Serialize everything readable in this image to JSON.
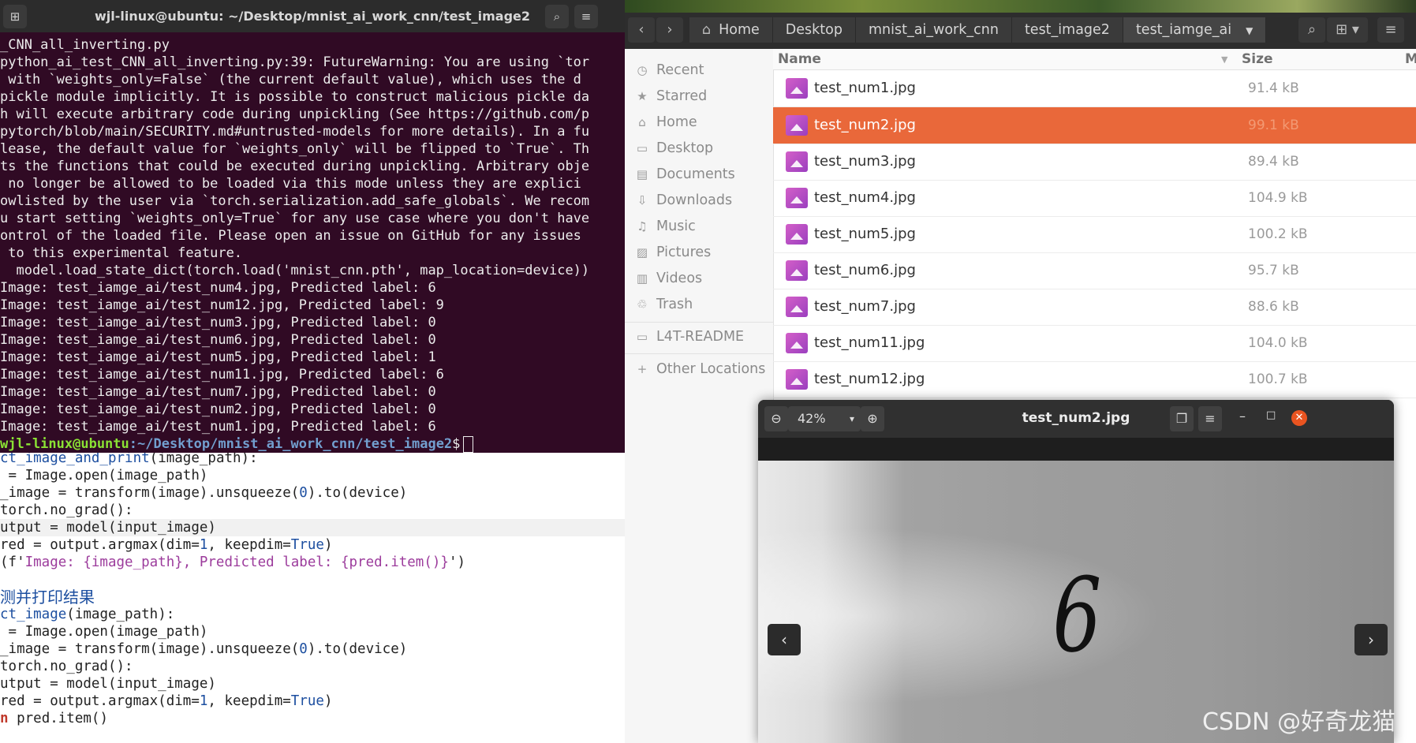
{
  "terminal": {
    "title": "wjl-linux@ubuntu: ~/Desktop/mnist_ai_work_cnn/test_image2",
    "lines": [
      "_CNN_all_inverting.py",
      "python_ai_test_CNN_all_inverting.py:39: FutureWarning: You are using `tor",
      " with `weights_only=False` (the current default value), which uses the d",
      "pickle module implicitly. It is possible to construct malicious pickle da",
      "h will execute arbitrary code during unpickling (See https://github.com/p",
      "pytorch/blob/main/SECURITY.md#untrusted-models for more details). In a fu",
      "lease, the default value for `weights_only` will be flipped to `True`. Th",
      "ts the functions that could be executed during unpickling. Arbitrary obje",
      " no longer be allowed to be loaded via this mode unless they are explici",
      "owlisted by the user via `torch.serialization.add_safe_globals`. We recom",
      "u start setting `weights_only=True` for any use case where you don't have",
      "ontrol of the loaded file. Please open an issue on GitHub for any issues",
      " to this experimental feature.",
      "  model.load_state_dict(torch.load('mnist_cnn.pth', map_location=device))",
      "Image: test_iamge_ai/test_num4.jpg, Predicted label: 6",
      "Image: test_iamge_ai/test_num12.jpg, Predicted label: 9",
      "Image: test_iamge_ai/test_num3.jpg, Predicted label: 0",
      "Image: test_iamge_ai/test_num6.jpg, Predicted label: 0",
      "Image: test_iamge_ai/test_num5.jpg, Predicted label: 1",
      "Image: test_iamge_ai/test_num11.jpg, Predicted label: 6",
      "Image: test_iamge_ai/test_num7.jpg, Predicted label: 0",
      "Image: test_iamge_ai/test_num2.jpg, Predicted label: 0",
      "Image: test_iamge_ai/test_num1.jpg, Predicted label: 6"
    ],
    "prompt_user": "wjl-linux@ubuntu",
    "prompt_path": ":~/Desktop/mnist_ai_work_cnn/test_image2",
    "prompt_symbol": "$"
  },
  "editor": {
    "func1_name": "ct_image_and_print",
    "func1_args": "(image_path):",
    "l2": " = Image.open(image_path)",
    "l3a": "_image = transform(image).unsqueeze(",
    "zero": "0",
    "l3b": ").to(device)",
    "l4": "torch.no_grad():",
    "l5": "utput = model(input_image)",
    "l6a": "red = output.argmax(dim=",
    "one": "1",
    "l6b": ", keepdim=",
    "true_kw": "True",
    "paren": ")",
    "l7a": "(f'",
    "l7str": "Image: {image_path}, Predicted label: {pred.item()}",
    "l7b": "')",
    "comment_cn": "测并打印结果",
    "func2_name": "ct_image",
    "func2_args": "(image_path):",
    "l11": " = Image.open(image_path)",
    "l12a": "_image = transform(image).unsqueeze(",
    "l12b": ").to(device)",
    "l13": "torch.no_grad():",
    "l14": "utput = model(input_image)",
    "l15a": "red = output.argmax(dim=",
    "l15b": ", keepdim=",
    "l16kw": "n",
    "l16": " pred.item()"
  },
  "files": {
    "nav_back": "‹",
    "nav_forward": "›",
    "breadcrumbs": [
      "Home",
      "Desktop",
      "mnist_ai_work_cnn",
      "test_image2",
      "test_iamge_ai"
    ],
    "sidebar": [
      {
        "label": "Recent",
        "icon": "◷"
      },
      {
        "label": "Starred",
        "icon": "★"
      },
      {
        "label": "Home",
        "icon": "⌂"
      },
      {
        "label": "Desktop",
        "icon": "▭"
      },
      {
        "label": "Documents",
        "icon": "▤"
      },
      {
        "label": "Downloads",
        "icon": "⇩"
      },
      {
        "label": "Music",
        "icon": "♫"
      },
      {
        "label": "Pictures",
        "icon": "▨"
      },
      {
        "label": "Videos",
        "icon": "▥"
      },
      {
        "label": "Trash",
        "icon": "♲"
      },
      {
        "label": "L4T-README",
        "icon": "▭"
      },
      {
        "label": "Other Locations",
        "icon": "+"
      }
    ],
    "col_name": "Name",
    "col_size": "Size",
    "col_more": "M",
    "rows": [
      {
        "name": "test_num1.jpg",
        "size": "91.4 kB",
        "selected": false
      },
      {
        "name": "test_num2.jpg",
        "size": "99.1 kB",
        "selected": true
      },
      {
        "name": "test_num3.jpg",
        "size": "89.4 kB",
        "selected": false
      },
      {
        "name": "test_num4.jpg",
        "size": "104.9 kB",
        "selected": false
      },
      {
        "name": "test_num5.jpg",
        "size": "100.2 kB",
        "selected": false
      },
      {
        "name": "test_num6.jpg",
        "size": "95.7 kB",
        "selected": false
      },
      {
        "name": "test_num7.jpg",
        "size": "88.6 kB",
        "selected": false
      },
      {
        "name": "test_num11.jpg",
        "size": "104.0 kB",
        "selected": false
      },
      {
        "name": "test_num12.jpg",
        "size": "100.7 kB",
        "selected": false
      }
    ]
  },
  "viewer": {
    "title": "test_num2.jpg",
    "zoom": "42%",
    "digit": "6",
    "prev": "‹",
    "next": "›"
  },
  "watermark": "CSDN @好奇龙猫",
  "colors": {
    "terminal_bg": "#300a24",
    "selection": "#e9683a",
    "prompt_user": "#8ae234",
    "prompt_path": "#729fcf"
  }
}
